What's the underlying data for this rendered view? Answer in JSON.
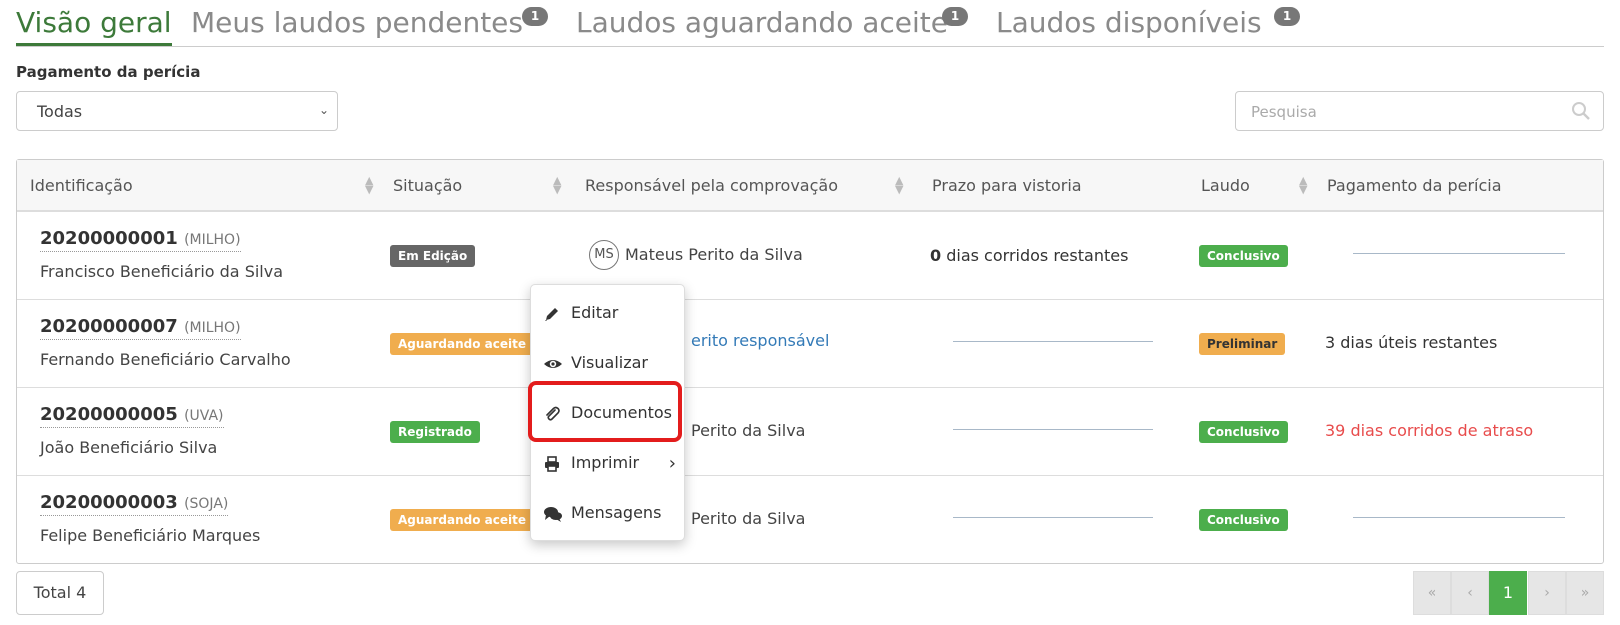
{
  "tabs": {
    "overview": "Visão geral",
    "pending": "Meus laudos pendentes",
    "pending_count": "1",
    "awaiting": "Laudos aguardando aceite",
    "awaiting_count": "1",
    "available": "Laudos disponíveis",
    "available_count": "1"
  },
  "filter": {
    "label": "Pagamento da perícia",
    "selected": "Todas"
  },
  "search": {
    "placeholder": "Pesquisa"
  },
  "table": {
    "headers": [
      "Identificação",
      "Situação",
      "Responsável pela comprovação",
      "Prazo para vistoria",
      "Laudo",
      "Pagamento da perícia"
    ],
    "rows": [
      {
        "id": "20200000001",
        "crop": "(MILHO)",
        "name": "Francisco Beneficiário da Silva",
        "status": "Em Edição",
        "avatar": "MS",
        "responsible": "Mateus Perito da Silva",
        "deadline_num": "0",
        "deadline_text": " dias corridos restantes",
        "report": "Conclusivo",
        "payment": ""
      },
      {
        "id": "20200000007",
        "crop": "(MILHO)",
        "name": "Fernando Beneficiário Carvalho",
        "status": "Aguardando aceite",
        "responsible": "erito responsável",
        "report": "Preliminar",
        "payment": "3 dias úteis restantes"
      },
      {
        "id": "20200000005",
        "crop": "(UVA)",
        "name": "João Beneficiário Silva",
        "status": "Registrado",
        "responsible": "Perito da Silva",
        "report": "Conclusivo",
        "payment": "39 dias corridos de atraso"
      },
      {
        "id": "20200000003",
        "crop": "(SOJA)",
        "name": "Felipe Beneficiário Marques",
        "status": "Aguardando aceite",
        "responsible": "Perito da Silva",
        "report": "Conclusivo",
        "payment": ""
      }
    ]
  },
  "context_menu": {
    "items": [
      "Editar",
      "Visualizar",
      "Documentos",
      "Imprimir",
      "Mensagens"
    ]
  },
  "footer": {
    "total": "Total 4",
    "pager": {
      "first": "«",
      "prev": "‹",
      "current": "1",
      "next": "›",
      "last": "»"
    }
  },
  "colors": {
    "accent": "#3d7a3a",
    "success": "#4cae4c",
    "warning": "#f0ad4e",
    "danger": "#e84c4c",
    "highlight": "#e31c1c"
  }
}
